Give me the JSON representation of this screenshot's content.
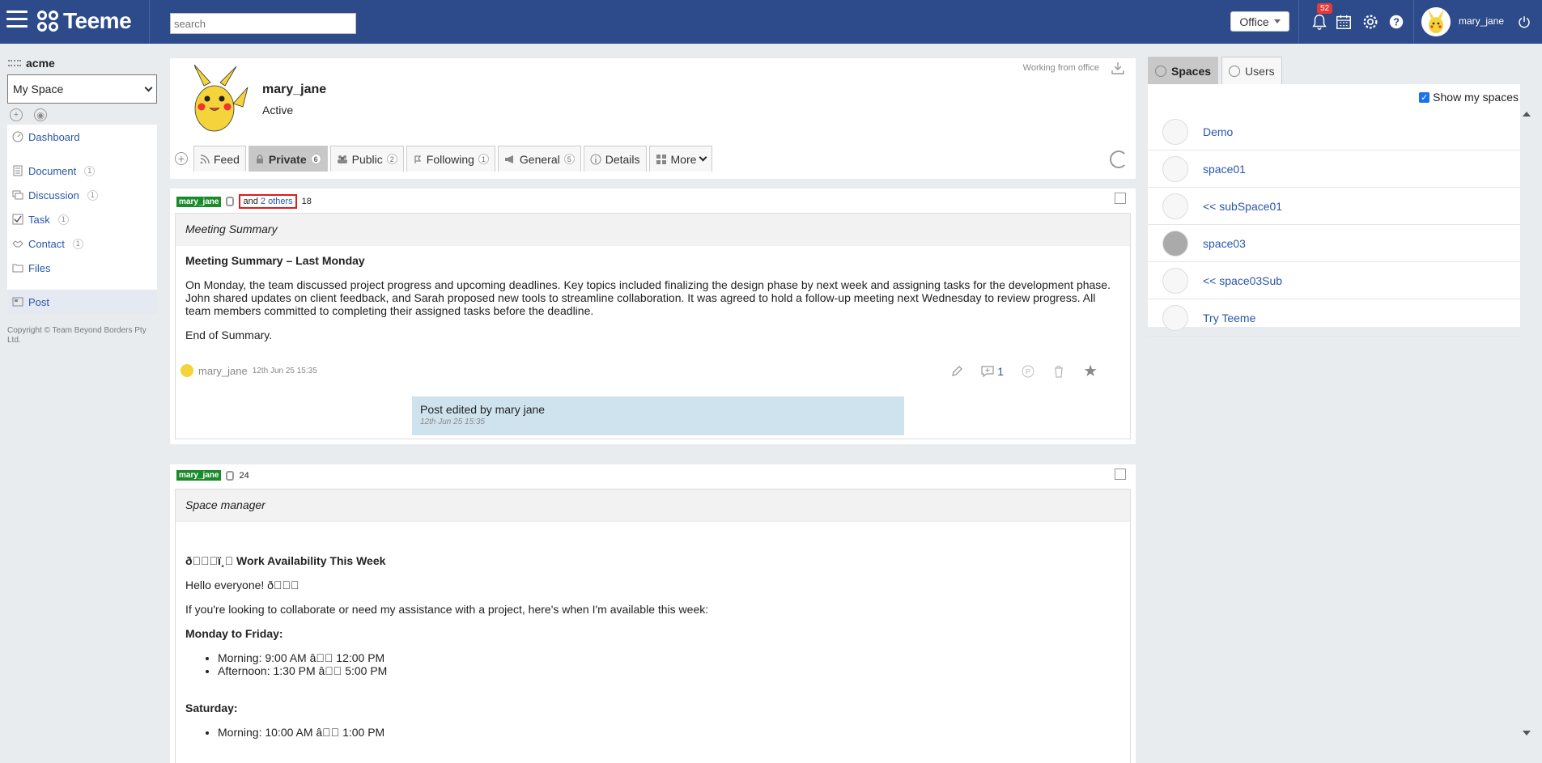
{
  "header": {
    "logo_text": "Teeme",
    "search_placeholder": "search",
    "office_label": "Office",
    "notifications_count": "52",
    "username": "mary_jane"
  },
  "sidebar": {
    "org_name": "acme",
    "space_select": "My Space",
    "items": [
      {
        "label": "Dashboard",
        "count": ""
      },
      {
        "label": "Document",
        "count": "1"
      },
      {
        "label": "Discussion",
        "count": "1"
      },
      {
        "label": "Task",
        "count": "1"
      },
      {
        "label": "Contact",
        "count": "1"
      },
      {
        "label": "Files",
        "count": ""
      },
      {
        "label": "Post",
        "count": ""
      }
    ],
    "copyright": "Copyright © Team Beyond Borders Pty Ltd."
  },
  "profile": {
    "name": "mary_jane",
    "status": "Active",
    "working_status": "Working from office",
    "tabs": [
      {
        "label": "Feed",
        "count": ""
      },
      {
        "label": "Private",
        "count": "6"
      },
      {
        "label": "Public",
        "count": "2"
      },
      {
        "label": "Following",
        "count": "1"
      },
      {
        "label": "General",
        "count": "5"
      },
      {
        "label": "Details",
        "count": ""
      },
      {
        "label": "More",
        "count": ""
      }
    ]
  },
  "posts": [
    {
      "author_tag": "mary_jane",
      "and_text": "and",
      "others_text": "2 others",
      "post_number": "18",
      "subject": "Meeting Summary",
      "heading": "Meeting Summary – Last Monday",
      "para1": "On Monday, the team discussed project progress and upcoming deadlines. Key topics included finalizing the design phase by next week and assigning tasks for the development phase. John shared updates on client feedback, and Sarah proposed new tools to streamline collaboration. It was agreed to hold a follow-up meeting next Wednesday to review progress. All team members committed to completing their assigned tasks before the deadline.",
      "para2": "End of Summary.",
      "meta_author": "mary_jane",
      "meta_date": "12th Jun 25 15:35",
      "comment_count": "1",
      "edited_text": "Post edited by mary jane",
      "edited_date": "12th Jun 25 15:35"
    },
    {
      "author_tag": "mary_jane",
      "post_number": "24",
      "subject": "Space manager",
      "heading": "ð\u0000\u0000\u0000ï¸\u0000 Work Availability This Week",
      "hello": "Hello everyone! ð\u0000\u0000\u0000",
      "intro": "If you're looking to collaborate or need my assistance with a project, here's when I'm available this week:",
      "mf_heading": "Monday to Friday:",
      "mf_items": [
        "Morning: 9:00 AM â\u0000\u0000 12:00 PM",
        "Afternoon: 1:30 PM â\u0000\u0000 5:00 PM"
      ],
      "sat_heading": "Saturday:",
      "sat_items": [
        "Morning: 10:00 AM â\u0000\u0000 1:00 PM"
      ]
    }
  ],
  "rightpanel": {
    "tabs": [
      "Spaces",
      "Users"
    ],
    "show_my_spaces": "Show my spaces",
    "spaces": [
      "Demo",
      "space01",
      "<< subSpace01",
      "space03",
      "<< space03Sub",
      "Try Teeme"
    ]
  }
}
